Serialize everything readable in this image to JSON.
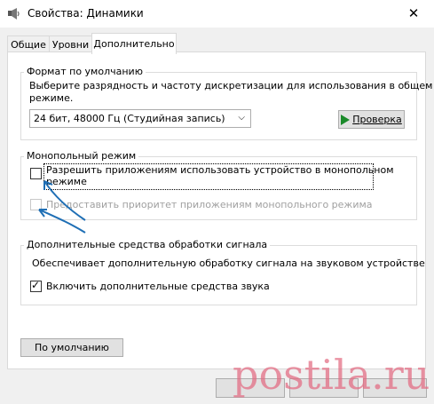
{
  "window": {
    "title": "Свойства: Динамики",
    "close_icon": "close-icon"
  },
  "tabs": [
    {
      "label": "Общие"
    },
    {
      "label": "Уровни"
    },
    {
      "label": "Дополнительно"
    }
  ],
  "default_format": {
    "group_title": "Формат по умолчанию",
    "description_line1": "Выберите разрядность и частоту дискретизации для использования в общем",
    "description_line2": "режиме.",
    "selected_format": "24 бит, 48000 Гц (Студийная запись)",
    "test_button": "Проверка"
  },
  "exclusive_mode": {
    "group_title": "Монопольный режим",
    "allow_label_line1": "Разрешить приложениям использовать устройство в монопольном",
    "allow_label_line2": "режиме",
    "allow_checked": false,
    "priority_label": "Предоставить приоритет приложениям монопольного режима",
    "priority_checked": false,
    "priority_enabled": false
  },
  "enhancements": {
    "group_title": "Дополнительные средства обработки сигнала",
    "description": "Обеспечивает дополнительную обработку сигнала на звуковом устройстве",
    "enable_label": "Включить дополнительные средства звука",
    "enable_checked": true
  },
  "default_button": "По умолчанию",
  "watermark": "postila.ru",
  "colors": {
    "annotation_arrow": "#1f6fb5",
    "watermark": "#e36b82",
    "play_icon": "#1a8a2a"
  }
}
